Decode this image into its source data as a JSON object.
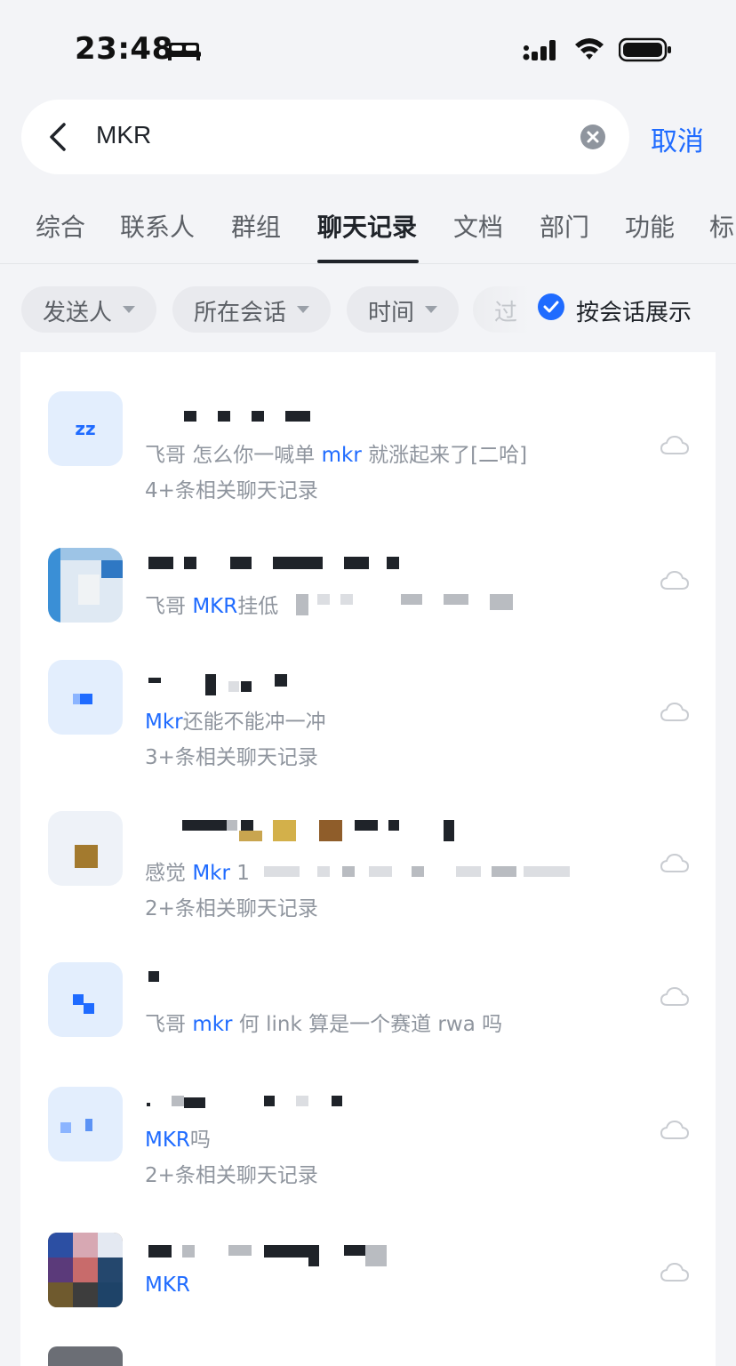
{
  "status_bar": {
    "time": "23:48"
  },
  "search": {
    "query": "MKR",
    "cancel_label": "取消"
  },
  "tabs": [
    {
      "label": "综合"
    },
    {
      "label": "联系人"
    },
    {
      "label": "群组"
    },
    {
      "label": "聊天记录",
      "active": true
    },
    {
      "label": "文档"
    },
    {
      "label": "部门"
    },
    {
      "label": "功能"
    },
    {
      "label": "标"
    }
  ],
  "filters": {
    "sender": "发送人",
    "conversation": "所在会话",
    "time": "时间",
    "faded": "过",
    "group_by_conversation": "按会话展示"
  },
  "results": [
    {
      "avatar_text": "zz",
      "prefix": "飞哥 怎么你一喊单 ",
      "keyword": "mkr",
      "suffix": " 就涨起来了[二哈]",
      "related": "4+条相关聊天记录"
    },
    {
      "prefix": "飞哥 ",
      "keyword": "MKR",
      "suffix": "挂低"
    },
    {
      "prefix": "",
      "keyword": "Mkr",
      "suffix": "还能不能冲一冲",
      "related": "3+条相关聊天记录"
    },
    {
      "prefix": "感觉 ",
      "keyword": "Mkr",
      "suffix": " 1",
      "related": "2+条相关聊天记录"
    },
    {
      "prefix": "飞哥 ",
      "keyword": "mkr",
      "suffix": " 何 link 算是一个赛道 rwa 吗"
    },
    {
      "prefix": "",
      "keyword": "MKR",
      "suffix": "吗",
      "related": "2+条相关聊天记录"
    },
    {
      "prefix": "",
      "keyword": "MKR",
      "suffix": ""
    }
  ],
  "colors": {
    "accent": "#1f6bff",
    "background": "#f3f4f7",
    "text_primary": "#1f2329",
    "text_secondary": "#8f959e"
  },
  "icons": [
    "bed-icon",
    "signal-icon",
    "wifi-icon",
    "battery-icon",
    "back-chevron-icon",
    "clear-icon",
    "caret-down-icon",
    "checkmark-icon",
    "cloud-icon"
  ]
}
